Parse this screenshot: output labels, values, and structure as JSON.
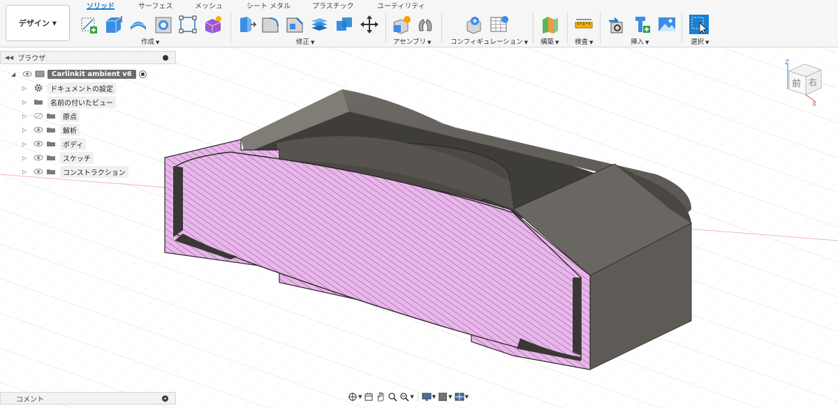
{
  "workspace": {
    "label": "デザイン"
  },
  "tabs": [
    "ソリッド",
    "サーフェス",
    "メッシュ",
    "シート メタル",
    "プラスチック",
    "ユーティリティ"
  ],
  "groups": [
    "作成",
    "修正",
    "アセンブリ",
    "コンフィギュレーション",
    "構築",
    "検査",
    "挿入",
    "選択"
  ],
  "browser": {
    "title": "ブラウザ",
    "root": "Carlinkit ambient v6",
    "items": [
      "ドキュメントの設定",
      "名前の付いたビュー",
      "原点",
      "解析",
      "ボディ",
      "スケッチ",
      "コンストラクション"
    ]
  },
  "viewcube": {
    "front": "前",
    "right": "右",
    "axis_z": "Z",
    "axis_x": "X"
  },
  "comments": {
    "title": "コメント"
  },
  "colors": {
    "accent": "#1a7fd0",
    "section_fill": "#e9b6ec",
    "body": "#5a5752",
    "hatch": "#7a4a7c"
  }
}
